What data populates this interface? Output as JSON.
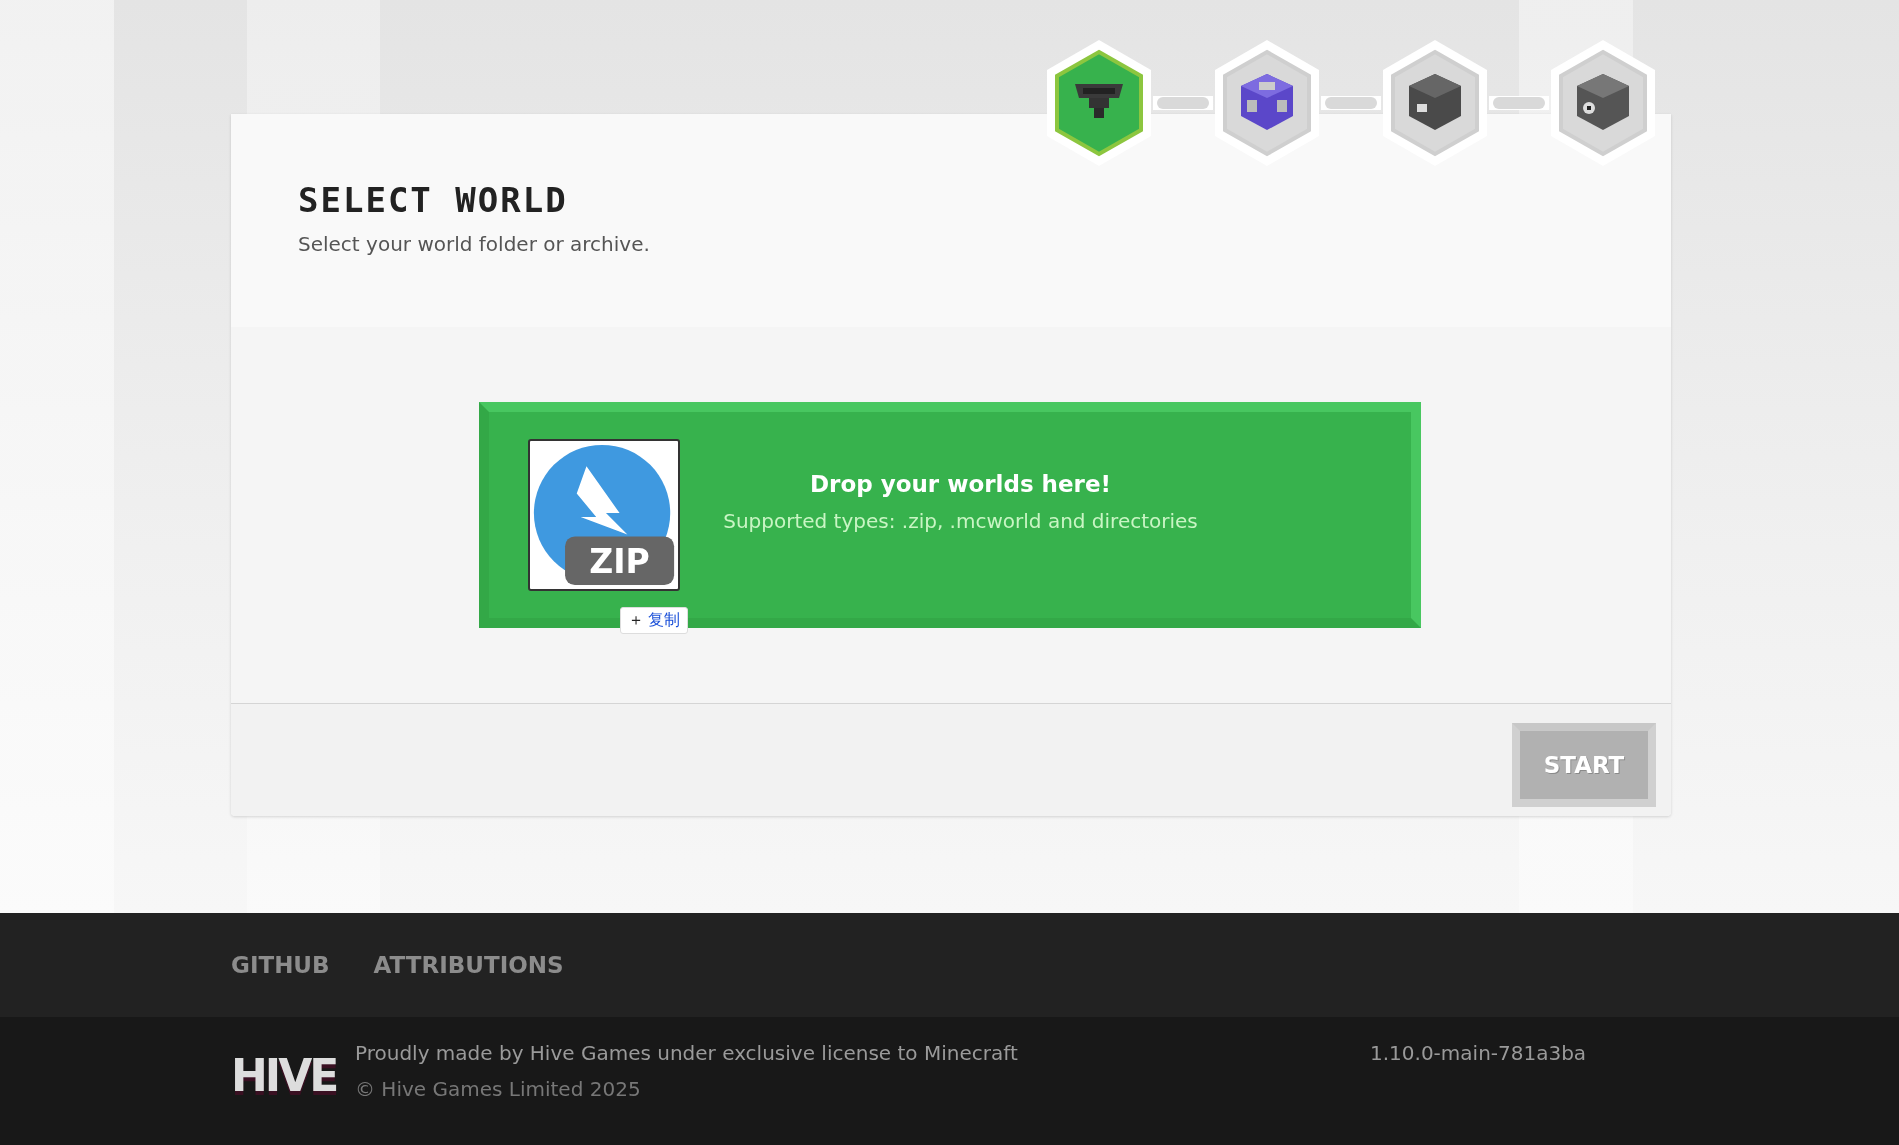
{
  "steps": [
    {
      "kind": "hopper",
      "selected": true
    },
    {
      "kind": "command-block",
      "selected": false
    },
    {
      "kind": "furnace",
      "selected": false
    },
    {
      "kind": "dispenser",
      "selected": false
    }
  ],
  "card": {
    "title": "SELECT WORLD",
    "subtitle": "Select your world folder or archive.",
    "dropzone": {
      "heading": "Drop your worlds here!",
      "note": "Supported types: .zip, .mcworld and directories",
      "file_badge": "ZIP",
      "copy_button": {
        "icon": "＋",
        "label": "复制"
      }
    },
    "start_button": {
      "label": "START",
      "disabled": true
    }
  },
  "footer": {
    "links": [
      "GITHUB",
      "ATTRIBUTIONS"
    ],
    "logo": "HIVE",
    "credit": "Proudly made by Hive Games under exclusive license to Minecraft",
    "copyright": "© Hive Games Limited 2025",
    "version": "1.10.0-main-781a3ba"
  }
}
